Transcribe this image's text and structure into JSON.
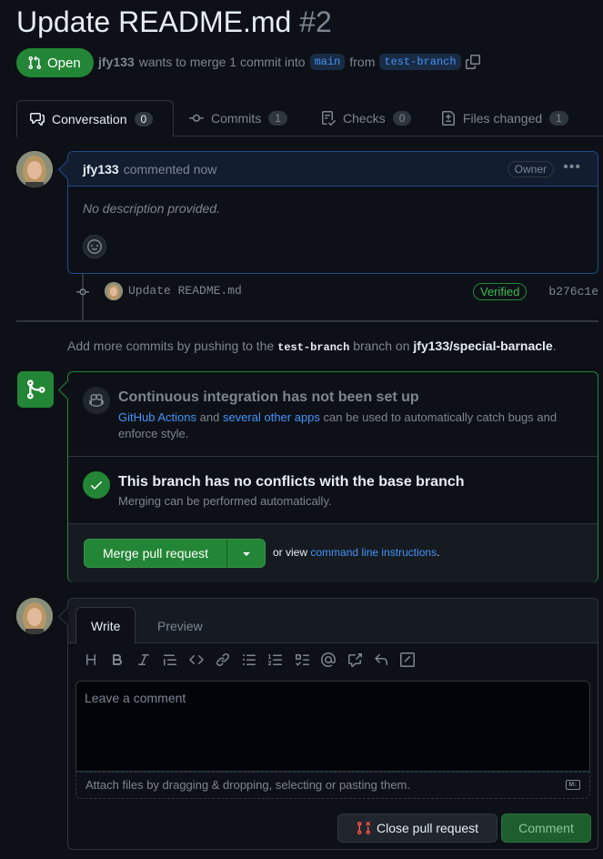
{
  "pr": {
    "title": "Update README.md",
    "number": "#2",
    "state": "Open",
    "author": "jfy133",
    "meta_text": "wants to merge 1 commit into",
    "base_branch": "main",
    "from_text": "from",
    "head_branch": "test-branch"
  },
  "tabs": [
    {
      "label": "Conversation",
      "count": "0"
    },
    {
      "label": "Commits",
      "count": "1"
    },
    {
      "label": "Checks",
      "count": "0"
    },
    {
      "label": "Files changed",
      "count": "1"
    }
  ],
  "comment": {
    "author": "jfy133",
    "action": "commented now",
    "role": "Owner",
    "body": "No description provided."
  },
  "commit": {
    "message": "Update README.md",
    "verified": "Verified",
    "sha": "b276c1e"
  },
  "push_note": {
    "prefix": "Add more commits by pushing to the",
    "branch": "test-branch",
    "middle": "branch on",
    "repo": "jfy133/special-barnacle",
    "suffix": "."
  },
  "merge": {
    "ci_title": "Continuous integration has not been set up",
    "ci_link1": "GitHub Actions",
    "ci_and": "and",
    "ci_link2": "several other apps",
    "ci_rest": "can be used to automatically catch bugs and enforce style.",
    "noconf_title": "This branch has no conflicts with the base branch",
    "noconf_sub": "Merging can be performed automatically.",
    "merge_button": "Merge pull request",
    "alt_prefix": "or view",
    "alt_link": "command line instructions",
    "alt_suffix": "."
  },
  "composer": {
    "tab_write": "Write",
    "tab_preview": "Preview",
    "placeholder": "Leave a comment",
    "attach_text": "Attach files by dragging & dropping, selecting or pasting them.",
    "md_badge": "M↓",
    "close_button": "Close pull request",
    "comment_button": "Comment"
  },
  "colors": {
    "success": "#238636",
    "accent": "#4493f8",
    "background": "#0d1117",
    "muted": "#7d8590"
  }
}
